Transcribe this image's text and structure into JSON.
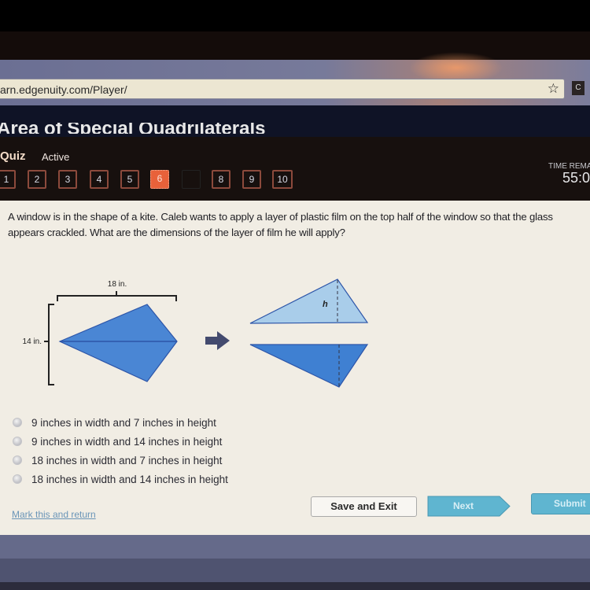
{
  "browser": {
    "url": "arn.edgenuity.com/Player/",
    "bookmark_icon": "star-icon",
    "extension_label": "C"
  },
  "header": {
    "course_title": "Area of Special Quadrilaterals",
    "activity_type": "Quiz",
    "status": "Active",
    "question_nav": [
      {
        "label": "1",
        "state": "default"
      },
      {
        "label": "2",
        "state": "default"
      },
      {
        "label": "3",
        "state": "default"
      },
      {
        "label": "4",
        "state": "default"
      },
      {
        "label": "5",
        "state": "default"
      },
      {
        "label": "6",
        "state": "current"
      },
      {
        "label": "",
        "state": "blank"
      },
      {
        "label": "8",
        "state": "default"
      },
      {
        "label": "9",
        "state": "default"
      },
      {
        "label": "10",
        "state": "default"
      }
    ],
    "time_label": "TIME REMA",
    "time_value": "55:0"
  },
  "question": {
    "text": "A window is in the shape of a kite. Caleb wants to apply a layer of plastic film on the top half of the window so that the glass appears crackled. What are the dimensions of the layer of film he will apply?"
  },
  "diagram": {
    "width_label": "18 in.",
    "height_label": "14 in.",
    "height_var": "h",
    "arrow_icon": "arrow-right-icon",
    "colors": {
      "kite_fill": "#4a86d4",
      "kite_stroke": "#2d55a8",
      "top_half_fill": "#a9cdea",
      "bottom_half_fill": "#3f80d2",
      "arrow": "#434a6e"
    }
  },
  "choices": [
    {
      "label": "9 inches in width and 7 inches in height",
      "selected": false
    },
    {
      "label": "9 inches in width and 14 inches in height",
      "selected": false
    },
    {
      "label": "18 inches in width and 7 inches in height",
      "selected": false
    },
    {
      "label": "18 inches in width and 14 inches in height",
      "selected": false
    }
  ],
  "footer": {
    "mark_link": "Mark this and return",
    "save_exit": "Save and Exit",
    "next": "Next",
    "submit": "Submit"
  },
  "colors": {
    "accent_orange": "#e8613a",
    "button_blue": "#5fb5d0",
    "link_blue": "#6a95b8"
  }
}
